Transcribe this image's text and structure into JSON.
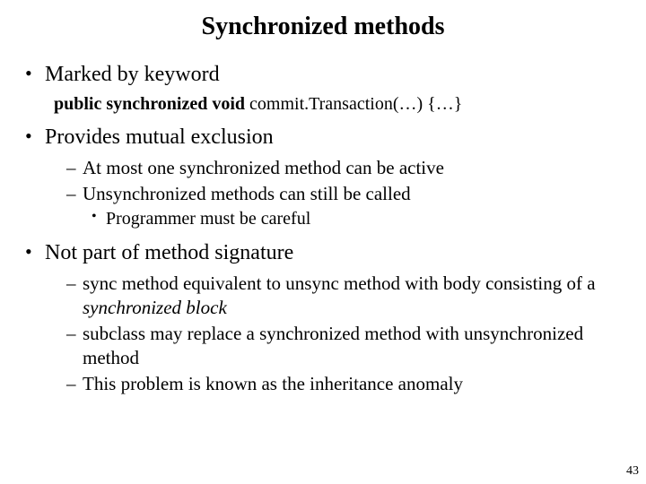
{
  "title": "Synchronized methods",
  "bullets": {
    "b1": "Marked by keyword",
    "code": {
      "kw": "public synchronized void",
      "rest": " commit.Transaction(…) {…}"
    },
    "b2": "Provides mutual exclusion",
    "b2_sub": {
      "s1": "At most one synchronized method can be active",
      "s2": "Unsynchronized methods can still be called",
      "s2_sub": "Programmer must be careful"
    },
    "b3": "Not part of method signature",
    "b3_sub": {
      "s1_a": "sync method equivalent to unsync method with body consisting of a ",
      "s1_b": "synchronized block",
      "s2": "subclass may replace a synchronized method with unsynchronized method",
      "s3": "This problem is known as the inheritance anomaly"
    }
  },
  "page_number": "43"
}
